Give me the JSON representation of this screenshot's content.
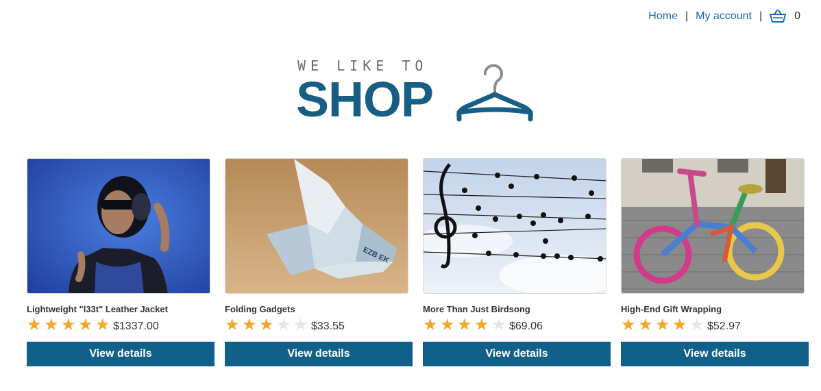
{
  "nav": {
    "home": "Home",
    "separator": "|",
    "account": "My account",
    "cart_icon": "basket-icon",
    "cart_count": "0"
  },
  "logo": {
    "tagline": "WE LIKE TO",
    "brand": "SHOP",
    "icon": "hanger-icon",
    "colors": {
      "brand": "#175e84",
      "tagline": "#6b6b6b"
    }
  },
  "products": [
    {
      "title": "Lightweight \"l33t\" Leather Jacket",
      "rating": 5,
      "max_rating": 5,
      "price": "$1337.00",
      "button": "View details"
    },
    {
      "title": "Folding Gadgets",
      "rating": 3,
      "max_rating": 5,
      "price": "$33.55",
      "button": "View details"
    },
    {
      "title": "More Than Just Birdsong",
      "rating": 4,
      "max_rating": 5,
      "price": "$69.06",
      "button": "View details"
    },
    {
      "title": "High-End Gift Wrapping",
      "rating": 4,
      "max_rating": 5,
      "price": "$52.97",
      "button": "View details"
    }
  ],
  "colors": {
    "link": "#1a6ab0",
    "button": "#10608a",
    "star_on": "#f5a623",
    "star_off": "#e2e6e9"
  }
}
